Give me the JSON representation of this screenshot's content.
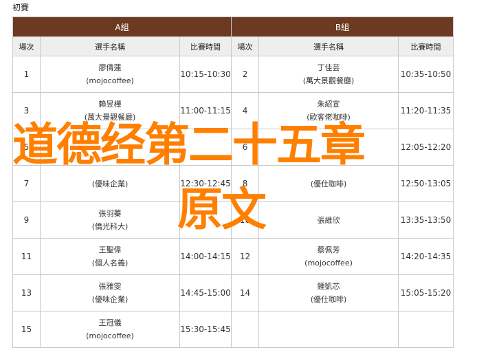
{
  "page_title": "初賽",
  "groups": [
    {
      "name": "A組",
      "headers": {
        "order": "場次",
        "players": "選手名稱",
        "time": "比賽時間"
      },
      "rows": [
        {
          "order": "1",
          "name": "廖倩蓮",
          "team": "(mojocoffee)",
          "time": "10:15-10:30"
        },
        {
          "order": "3",
          "name": "賴昱樺",
          "team": "(萬大景觀餐廳)",
          "time": "11:00-11:15"
        },
        {
          "order": "5",
          "name": "",
          "team": "",
          "time": ""
        },
        {
          "order": "7",
          "name": "",
          "team": "(優味企業)",
          "time": "12:30-12:45"
        },
        {
          "order": "9",
          "name": "張羽蓁",
          "team": "(僑光科大)",
          "time": ""
        },
        {
          "order": "11",
          "name": "王聖偉",
          "team": "(個人名義)",
          "time": "14:00-14:15"
        },
        {
          "order": "13",
          "name": "張雅雯",
          "team": "(優味企業)",
          "time": "14:45-15:00"
        },
        {
          "order": "15",
          "name": "王冠儀",
          "team": "(mojocoffee)",
          "time": "15:30-15:45"
        }
      ]
    },
    {
      "name": "B組",
      "headers": {
        "order": "場次",
        "players": "選手名稱",
        "time": "比賽時間"
      },
      "rows": [
        {
          "order": "2",
          "name": "丁佳芸",
          "team": "(萬大景觀餐廳)",
          "time": "10:35-10:50"
        },
        {
          "order": "4",
          "name": "朱紹宣",
          "team": "(歐客佬咖啡)",
          "time": "11:20-11:35"
        },
        {
          "order": "6",
          "name": "",
          "team": "",
          "time": "12:05-12:20"
        },
        {
          "order": "8",
          "name": "",
          "team": "(優仕咖啡)",
          "time": "12:50-13:05"
        },
        {
          "order": "10",
          "name": "張維欣",
          "team": "",
          "time": "13:35-13:50"
        },
        {
          "order": "12",
          "name": "蔡佩芳",
          "team": "(mojocoffee)",
          "time": "14:20-14:35"
        },
        {
          "order": "14",
          "name": "鍾凱芯",
          "team": "(優仕咖啡)",
          "time": "15:05-15:20"
        },
        {
          "order": "",
          "name": "",
          "team": "",
          "time": ""
        }
      ]
    }
  ],
  "overlay": {
    "line1": "道德经第二十五章",
    "line2": "原文"
  },
  "colors": {
    "group_header_bg": "#6b3a21",
    "col_header_bg": "#eeeeee",
    "overlay_text": "#ff7f00"
  }
}
